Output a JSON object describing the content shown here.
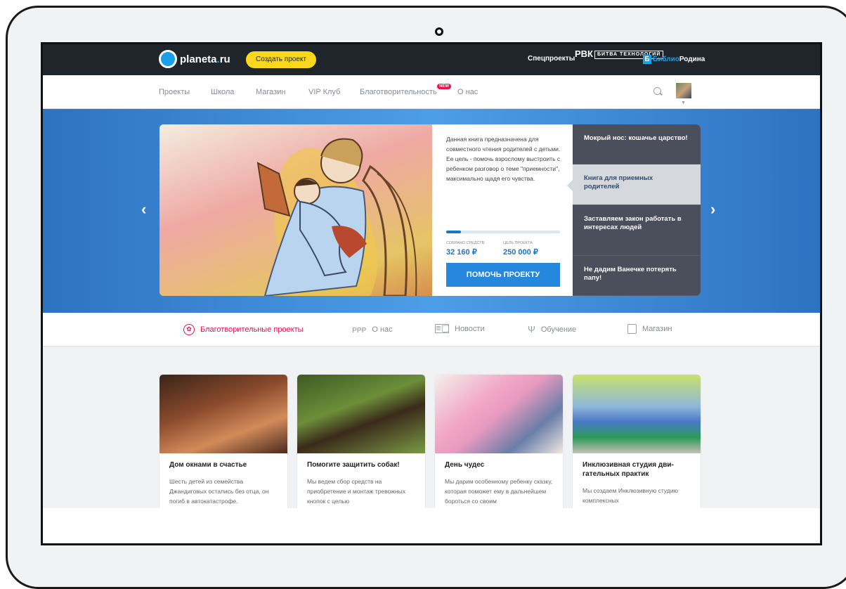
{
  "header": {
    "logo_text": "planeta",
    "logo_domain": "ru",
    "create_button": "Создать проект",
    "special_projects": "Спецпроекты",
    "rbk_label": "РВК",
    "rbk_sub": "БИТВА ТЕХНОЛОГИЙ",
    "biblio_box": "Б",
    "biblio_part1": "Библио",
    "biblio_part2": "Родина"
  },
  "nav": {
    "items": [
      "Проекты",
      "Школа",
      "Магазин",
      "VIP Клуб",
      "Благотворительность",
      "О нас"
    ],
    "new_badge": "NEW"
  },
  "hero": {
    "description": "Данная книга предназначена для совместного чтения родителей с детьми. Ее цель - помочь взрослому выстроить с ребенком разговор о теме \"приемности\", максимально щадя его чувства.",
    "raised_label": "СОБРАНО СРЕДСТВ",
    "raised_value": "32 160 ₽",
    "goal_label": "ЦЕЛЬ ПРОЕКТА",
    "goal_value": "250 000 ₽",
    "progress_fraction": 0.13,
    "help_button": "ПОМОЧЬ ПРОЕКТУ",
    "side_items": [
      "Мокрый нос: кошачье царство!",
      "Книга для приемных родителей",
      "Заставляем закон работать в интересах людей",
      "Не дадим Ванечке потерять папу!"
    ],
    "active_index": 1,
    "prev_arrow": "‹",
    "next_arrow": "›"
  },
  "categories": [
    {
      "label": "Благотворительные проекты",
      "icon": "charity-icon"
    },
    {
      "label": "О нас",
      "icon": "people-icon"
    },
    {
      "label": "Новости",
      "icon": "news-icon"
    },
    {
      "label": "Обучение",
      "icon": "sprout-icon"
    },
    {
      "label": "Магазин",
      "icon": "bag-icon"
    }
  ],
  "projects": [
    {
      "title": "Дом окнами в счастье",
      "text": "Шесть детей из семейства Джандиговых остались без отца, он погиб в автокатастрофе."
    },
    {
      "title": "Помогите защитить собак!",
      "text": "Мы ведем сбор средств на приобретение и монтаж тревожных кнопок с целью"
    },
    {
      "title": "День чудес",
      "text": "Мы дарим особенному ребенку сказку, которая поможет ему в дальнейшем бороться со своим"
    },
    {
      "title": "Инклюзивная студия дви-гательных практик",
      "text": "Мы создаем Инклюзивную студию комплексных"
    }
  ],
  "colors": {
    "accent_blue": "#1a74c9",
    "brand_yellow": "#f9d71c",
    "charity_pink": "#e8134b",
    "topbar_dark": "#1e262c"
  }
}
